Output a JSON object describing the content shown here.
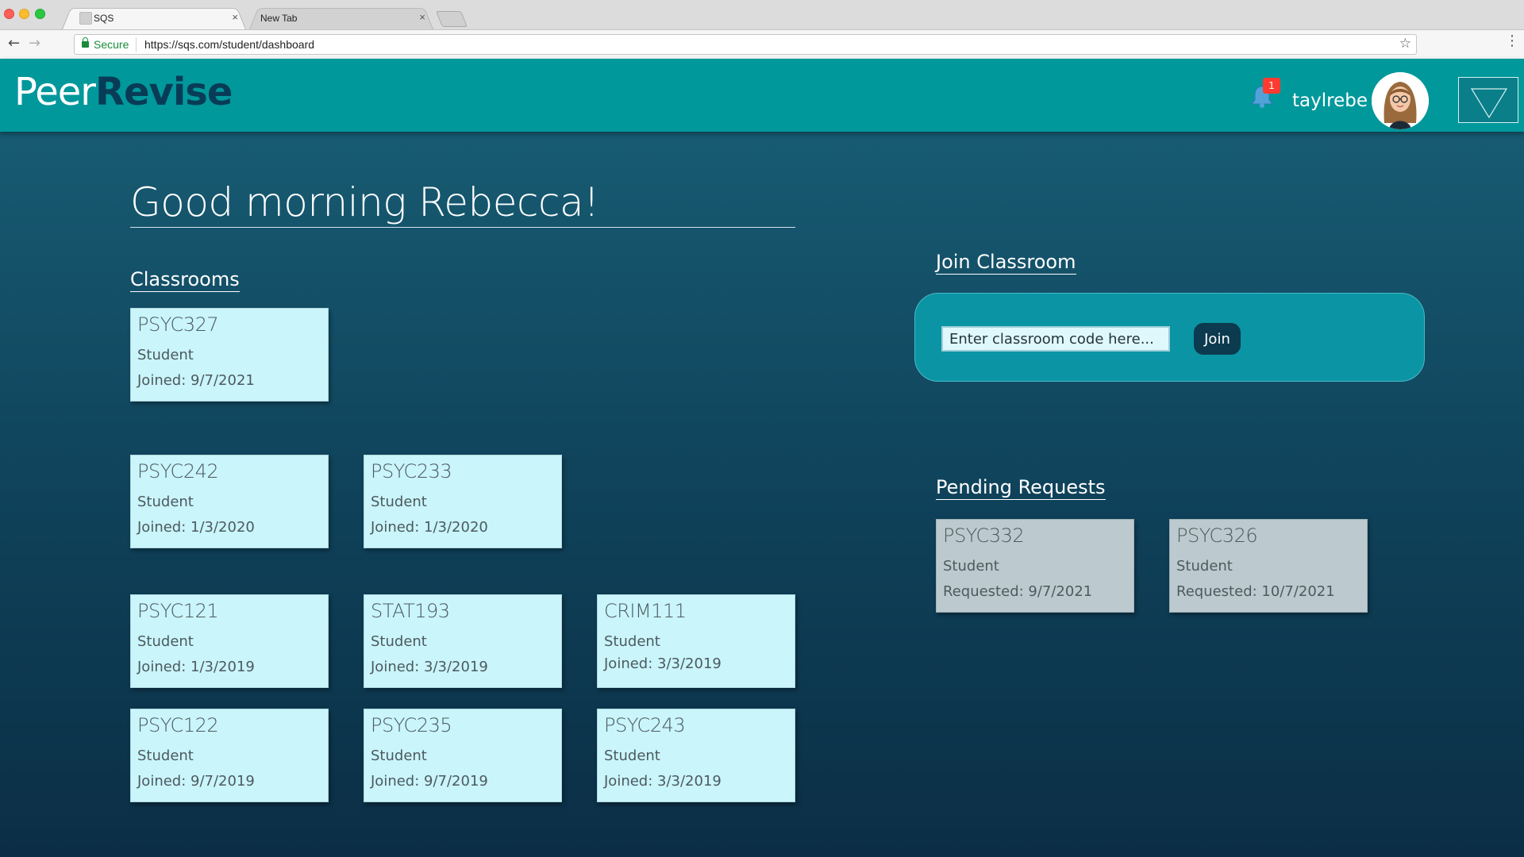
{
  "browser": {
    "tabs": [
      {
        "title": "SQS",
        "active": true
      },
      {
        "title": "New Tab",
        "active": false
      }
    ],
    "close_glyph": "×",
    "secure_label": "Secure",
    "url": "https://sqs.com/student/dashboard",
    "icons": {
      "back": "arrow-left-icon",
      "forward": "arrow-right-icon",
      "reload": "reload-icon",
      "bookmark": "star-icon",
      "menu": "more-vertical-icon"
    }
  },
  "header": {
    "logo_part1": "Peer",
    "logo_part2": "Revise",
    "notifications_count": "1",
    "username": "taylrebe",
    "colors": {
      "header_bg": "#01989b",
      "logo_dark": "#083c56",
      "badge": "#ff3b30"
    }
  },
  "main": {
    "greeting": "Good morning Rebecca!",
    "classrooms_title": "Classrooms",
    "classrooms": [
      {
        "name": "PSYC327",
        "role": "Student",
        "date": "Joined: 9/7/2021"
      },
      {
        "name": "PSYC242",
        "role": "Student",
        "date": "Joined: 1/3/2020"
      },
      {
        "name": "PSYC233",
        "role": "Student",
        "date": "Joined: 1/3/2020"
      },
      {
        "name": "PSYC121",
        "role": "Student",
        "date": "Joined: 1/3/2019"
      },
      {
        "name": "STAT193",
        "role": "Student",
        "date": "Joined: 3/3/2019"
      },
      {
        "name": "CRIM111",
        "role": "Student",
        "date": "Joined: 3/3/2019"
      },
      {
        "name": "PSYC122",
        "role": "Student",
        "date": "Joined: 9/7/2019"
      },
      {
        "name": "PSYC235",
        "role": "Student",
        "date": "Joined: 9/7/2019"
      },
      {
        "name": "PSYC243",
        "role": "Student",
        "date": "Joined: 3/3/2019"
      }
    ],
    "join": {
      "title": "Join Classroom",
      "placeholder": "Enter classroom code here...",
      "button_label": "Join"
    },
    "pending": {
      "title": "Pending Requests",
      "items": [
        {
          "name": "PSYC332",
          "role": "Student",
          "date": "Requested: 9/7/2021"
        },
        {
          "name": "PSYC326",
          "role": "Student",
          "date": "Requested: 10/7/2021"
        }
      ]
    }
  }
}
